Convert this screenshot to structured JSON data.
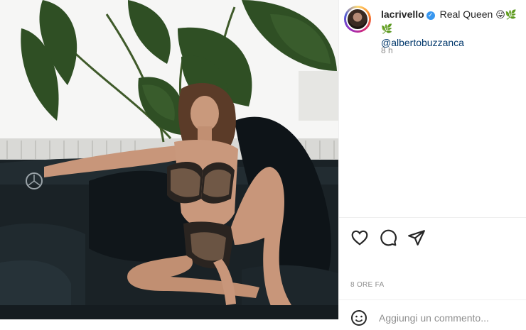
{
  "post": {
    "image_description_icon": "photo",
    "author": {
      "username": "lacrivello",
      "verified_icon": "verified-check-icon"
    },
    "caption": {
      "text": "Real Queen",
      "emojis": "😜🌿🌿",
      "mention": "@albertobuzzanca"
    },
    "caption_time": "8 h",
    "post_time": "8 ORE FA",
    "actions": {
      "like_icon": "heart-icon",
      "comment_icon": "comment-icon",
      "share_icon": "share-icon"
    },
    "comment_box": {
      "emoji_icon": "smiley-icon",
      "placeholder": "Aggiungi un commento..."
    }
  },
  "colors": {
    "text": "#262626",
    "muted": "#8e8e8e",
    "link": "#00376b",
    "verified": "#3897f0"
  }
}
